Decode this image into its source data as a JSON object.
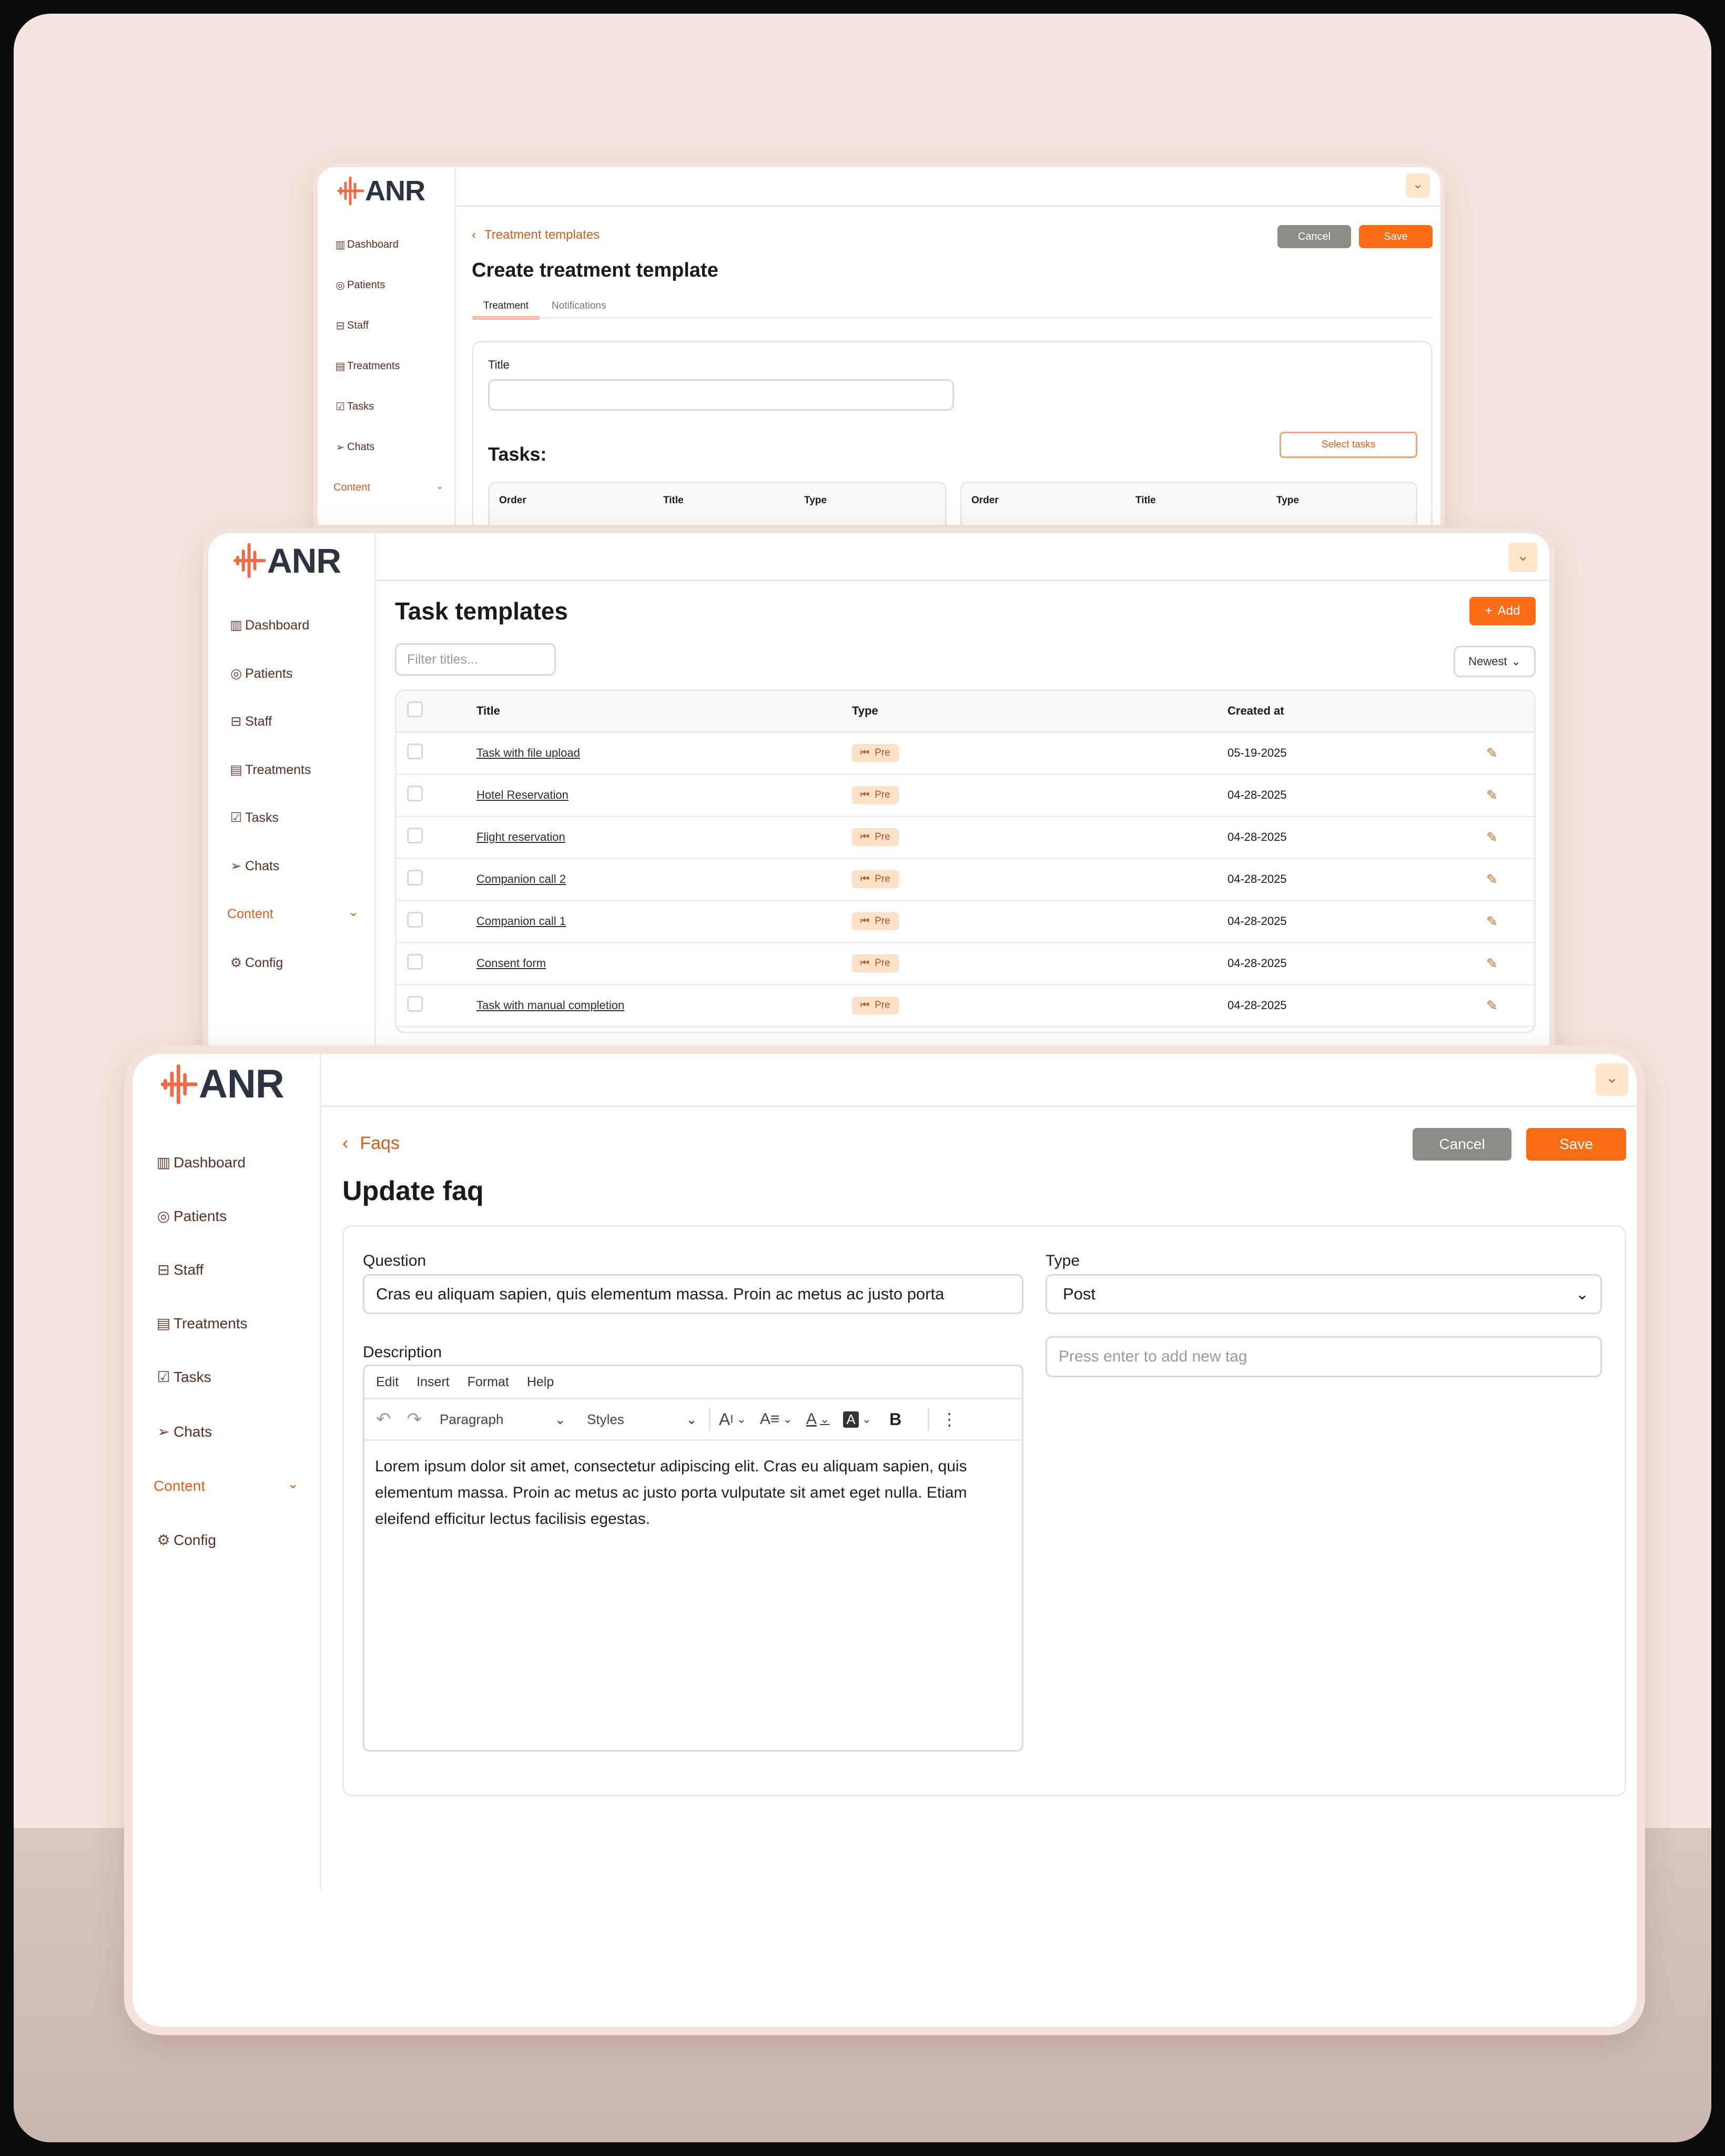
{
  "brand": {
    "logo_text": "ANR",
    "accent": "#f96d16",
    "background": "#f6e4de"
  },
  "sidebar": {
    "items": [
      {
        "label": "Dashboard",
        "icon": "bar-chart-icon"
      },
      {
        "label": "Patients",
        "icon": "user-circle-icon"
      },
      {
        "label": "Staff",
        "icon": "briefcase-icon"
      },
      {
        "label": "Treatments",
        "icon": "id-card-icon"
      },
      {
        "label": "Tasks",
        "icon": "checkbox-icon"
      },
      {
        "label": "Chats",
        "icon": "send-icon"
      },
      {
        "label": "Content",
        "icon": "chevron-down-icon"
      },
      {
        "label": "Config",
        "icon": "gear-icon"
      }
    ]
  },
  "treatment_window": {
    "breadcrumb": "Treatment templates",
    "title": "Create treatment template",
    "cancel_label": "Cancel",
    "save_label": "Save",
    "tabs": [
      "Treatment",
      "Notifications"
    ],
    "title_label": "Title",
    "title_value": "",
    "tasks_heading": "Tasks:",
    "select_tasks_label": "Select tasks",
    "columns": [
      "Order",
      "Title",
      "Type"
    ]
  },
  "task_window": {
    "title": "Task templates",
    "add_label": "Add",
    "filter_placeholder": "Filter titles...",
    "sort_value": "Newest",
    "columns": [
      "Title",
      "Type",
      "Created at"
    ],
    "rows": [
      {
        "title": "Task with file upload",
        "type": "Pre",
        "created_at": "05-19-2025"
      },
      {
        "title": "Hotel Reservation",
        "type": "Pre",
        "created_at": "04-28-2025"
      },
      {
        "title": "Flight reservation",
        "type": "Pre",
        "created_at": "04-28-2025"
      },
      {
        "title": "Companion call 2",
        "type": "Pre",
        "created_at": "04-28-2025"
      },
      {
        "title": "Companion call 1",
        "type": "Pre",
        "created_at": "04-28-2025"
      },
      {
        "title": "Consent form",
        "type": "Pre",
        "created_at": "04-28-2025"
      },
      {
        "title": "Task with manual completion",
        "type": "Pre",
        "created_at": "04-28-2025"
      }
    ]
  },
  "faq_window": {
    "breadcrumb": "Faqs",
    "title": "Update faq",
    "cancel_label": "Cancel",
    "save_label": "Save",
    "question_label": "Question",
    "question_value": "Cras eu aliquam sapien, quis elementum massa. Proin ac metus ac justo porta",
    "type_label": "Type",
    "type_value": "Post",
    "tags_placeholder": "Press enter to add new tag",
    "description_label": "Description",
    "editor_menu": [
      "Edit",
      "Insert",
      "Format",
      "Help"
    ],
    "block_format": "Paragraph",
    "styles": "Styles",
    "bold_glyph": "B",
    "description_text": "Lorem ipsum dolor sit amet, consectetur adipiscing elit. Cras eu aliquam sapien, quis elementum massa. Proin ac metus ac justo porta vulputate sit amet eget nulla. Etiam eleifend efficitur lectus facilisis egestas."
  }
}
